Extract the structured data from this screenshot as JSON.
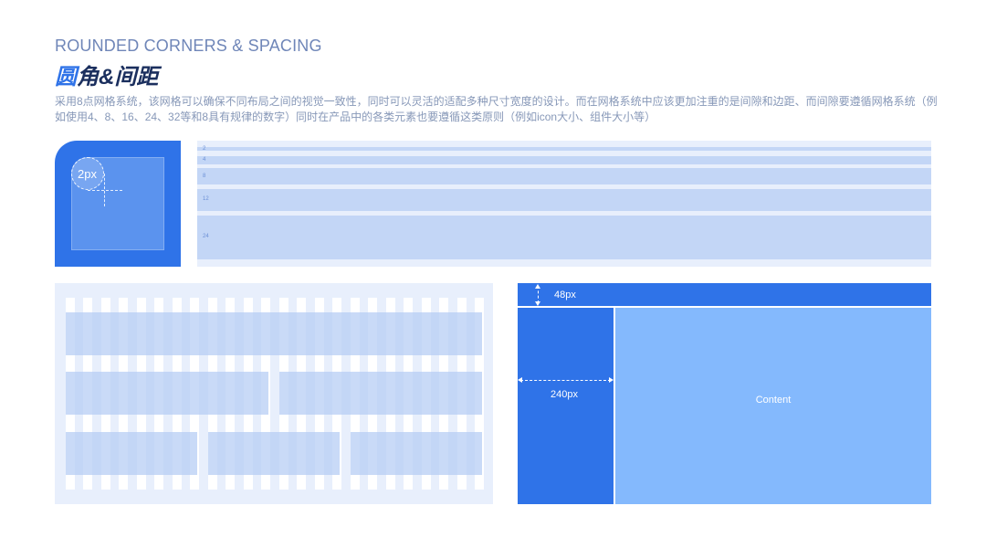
{
  "header": {
    "subtitle_en": "ROUNDED CORNERS & SPACING",
    "title_accent": "圆",
    "title_rest": "角&间距",
    "description": "采用8点网格系统，该网格可以确保不同布局之间的视觉一致性，同时可以灵活的适配多种尺寸宽度的设计。而在网格系统中应该更加注重的是间隙和边距、而间隙要遵循网格系统（例如使用4、8、16、24、32等和8具有规律的数字）同时在产品中的各类元素也要遵循这类原则（例如icon大小、组件大小等）"
  },
  "corner_demo": {
    "radius_label": "2px"
  },
  "spacing_demo": {
    "labels": [
      "2",
      "4",
      "8",
      "12",
      "24"
    ]
  },
  "layout_demo": {
    "header_height_label": "48px",
    "sidebar_width_label": "240px",
    "content_label": "Content"
  },
  "colors": {
    "primary": "#2f73e8",
    "content_blue": "#84b9fd",
    "panel_bg": "#e8effc",
    "bar_blue": "#c3d6f6",
    "title_dark": "#1b2f5e",
    "text_muted": "#8798b8"
  }
}
